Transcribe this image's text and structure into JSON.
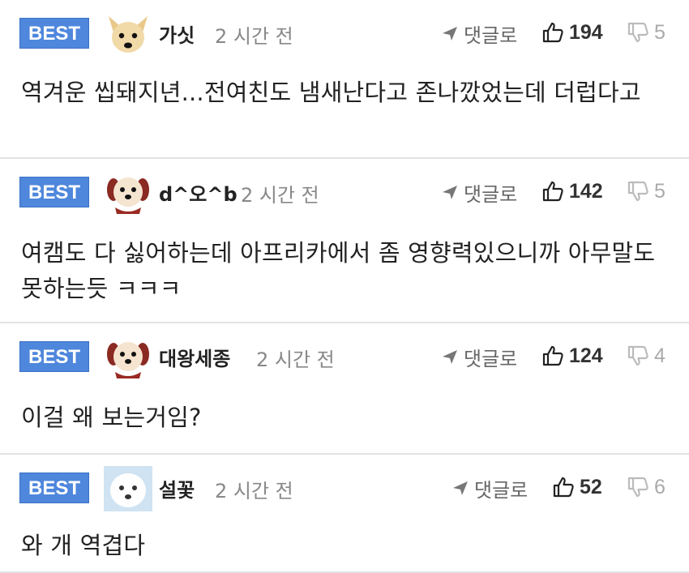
{
  "comments": [
    {
      "badge": "BEST",
      "nickname": "가싯",
      "time": "2 시간 전",
      "reply_label": "댓글로",
      "likes": "194",
      "dislikes": "5",
      "text": "역겨운 씹돼지년...전여친도 냄새난다고 존나깠었는데 더럽다고",
      "avatar_icon": "chihuahua-avatar-icon"
    },
    {
      "badge": "BEST",
      "nickname": "d^오^b",
      "time": "2 시간 전",
      "reply_label": "댓글로",
      "likes": "142",
      "dislikes": "5",
      "text": "여캠도 다 싫어하는데 아프리카에서 좀 영향력있으니까 아무말도 못하는듯 ㅋㅋㅋ",
      "avatar_icon": "puppy-avatar-icon"
    },
    {
      "badge": "BEST",
      "nickname": "대왕세종",
      "time": "2 시간 전",
      "reply_label": "댓글로",
      "likes": "124",
      "dislikes": "4",
      "text": "이걸 왜 보는거임?",
      "avatar_icon": "puppy-avatar-icon"
    },
    {
      "badge": "BEST",
      "nickname": "설꽃",
      "time": "2 시간 전",
      "reply_label": "댓글로",
      "likes": "52",
      "dislikes": "6",
      "text": "와 개 역겹다",
      "avatar_icon": "white-dog-avatar-icon"
    }
  ],
  "colors": {
    "badge_bg": "#4e87dc",
    "divider": "#e3e3e3",
    "muted_text": "#888888",
    "dislike_icon": "#bbbbbb"
  }
}
